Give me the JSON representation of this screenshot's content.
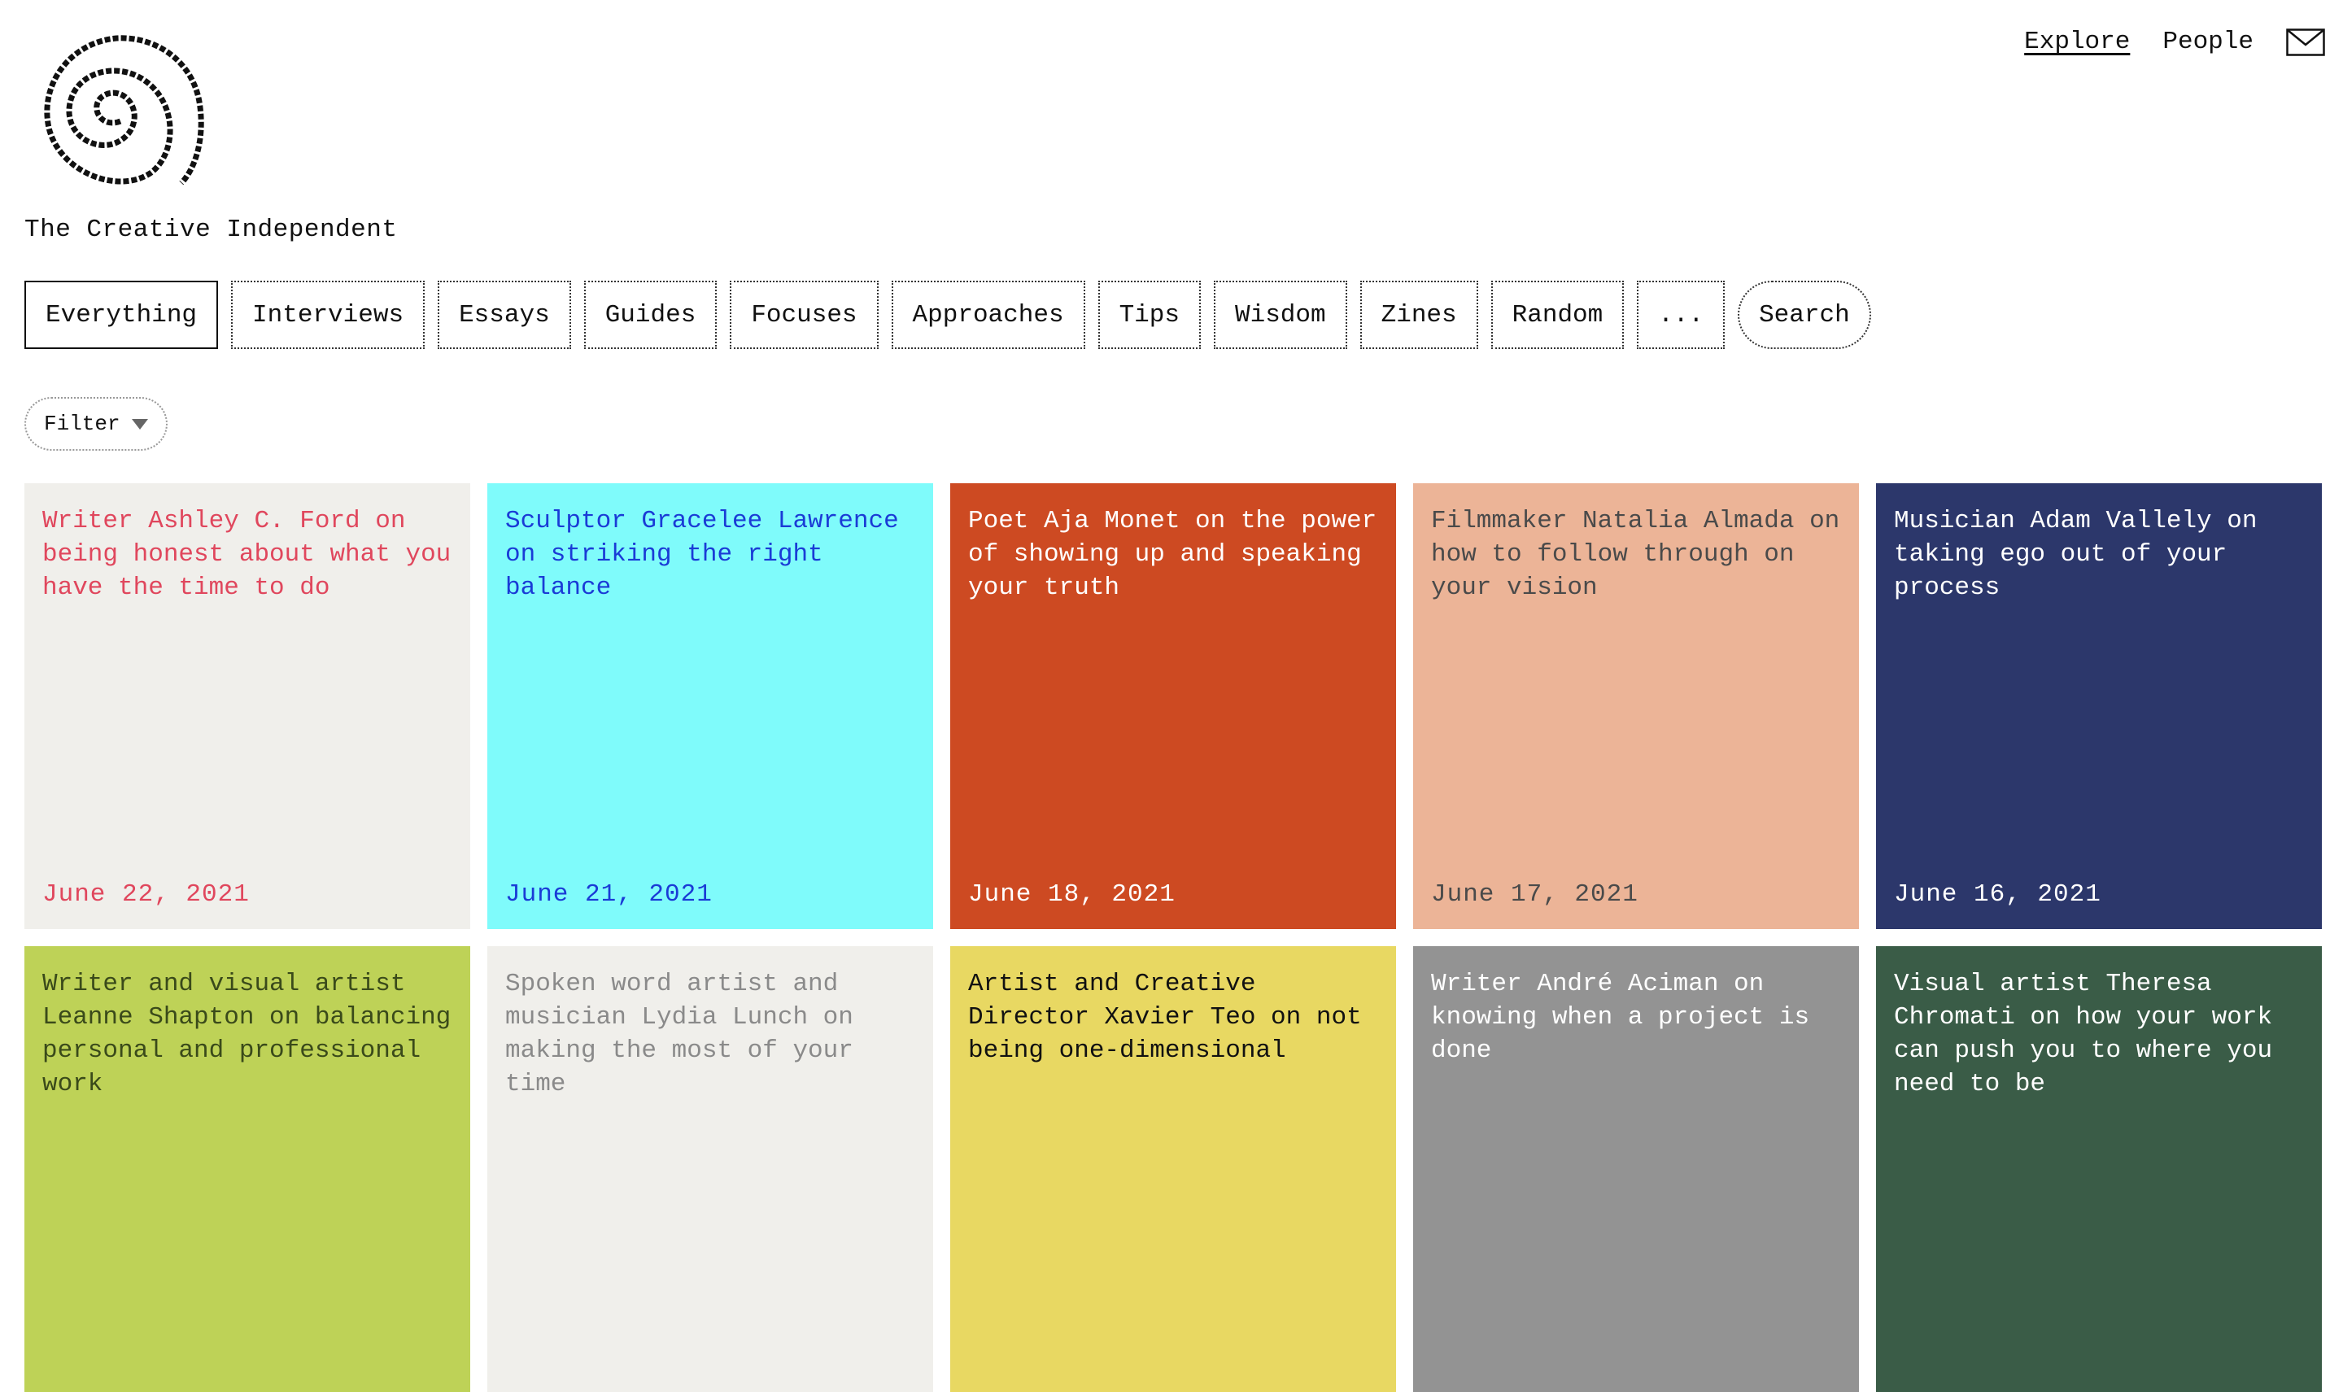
{
  "site": {
    "title": "The Creative Independent"
  },
  "topnav": [
    {
      "label": "Explore",
      "active": true
    },
    {
      "label": "People",
      "active": false
    }
  ],
  "icons": {
    "logo": "spiral-logo-icon",
    "mail": "envelope-icon",
    "filter": "triangle-down-icon"
  },
  "tabs": [
    "Everything",
    "Interviews",
    "Essays",
    "Guides",
    "Focuses",
    "Approaches",
    "Tips",
    "Wisdom",
    "Zines",
    "Random",
    "...",
    "Search"
  ],
  "filter": {
    "label": "Filter"
  },
  "cards": [
    {
      "title": "Writer Ashley C. Ford on being honest about what you have the time to do",
      "date": "June 22, 2021",
      "bg": "#f0efeb",
      "fg": "#e0475d"
    },
    {
      "title": "Sculptor Gracelee Lawrence on striking the right balance",
      "date": "June 21, 2021",
      "bg": "#7ffbfb",
      "fg": "#1a3bd6"
    },
    {
      "title": "Poet Aja Monet on the power of showing up and speaking your truth",
      "date": "June 18, 2021",
      "bg": "#cd4a22",
      "fg": "#ffffff"
    },
    {
      "title": "Filmmaker Natalia Almada on how to follow through on your vision",
      "date": "June 17, 2021",
      "bg": "#ecb497",
      "fg": "#4a4a4a"
    },
    {
      "title": "Musician Adam Vallely on taking ego out of your process",
      "date": "June 16, 2021",
      "bg": "#2c376b",
      "fg": "#ffffff"
    },
    {
      "title": "Writer and visual artist Leanne Shapton on balancing personal and professional work",
      "date": "",
      "bg": "#bed257",
      "fg": "#3a4a1a"
    },
    {
      "title": "Spoken word artist and musician Lydia Lunch on making the most of your time",
      "date": "",
      "bg": "#f0efeb",
      "fg": "#8a8a8a"
    },
    {
      "title": "Artist and Creative Director Xavier Teo on not being one-dimensional",
      "date": "",
      "bg": "#e8d862",
      "fg": "#111111"
    },
    {
      "title": "Writer André Aciman on knowing when a project is done",
      "date": "",
      "bg": "#939393",
      "fg": "#ffffff"
    },
    {
      "title": "Visual artist Theresa Chromati on how your work can push you to where you need to be",
      "date": "",
      "bg": "#3a5c47",
      "fg": "#ffffff"
    }
  ]
}
